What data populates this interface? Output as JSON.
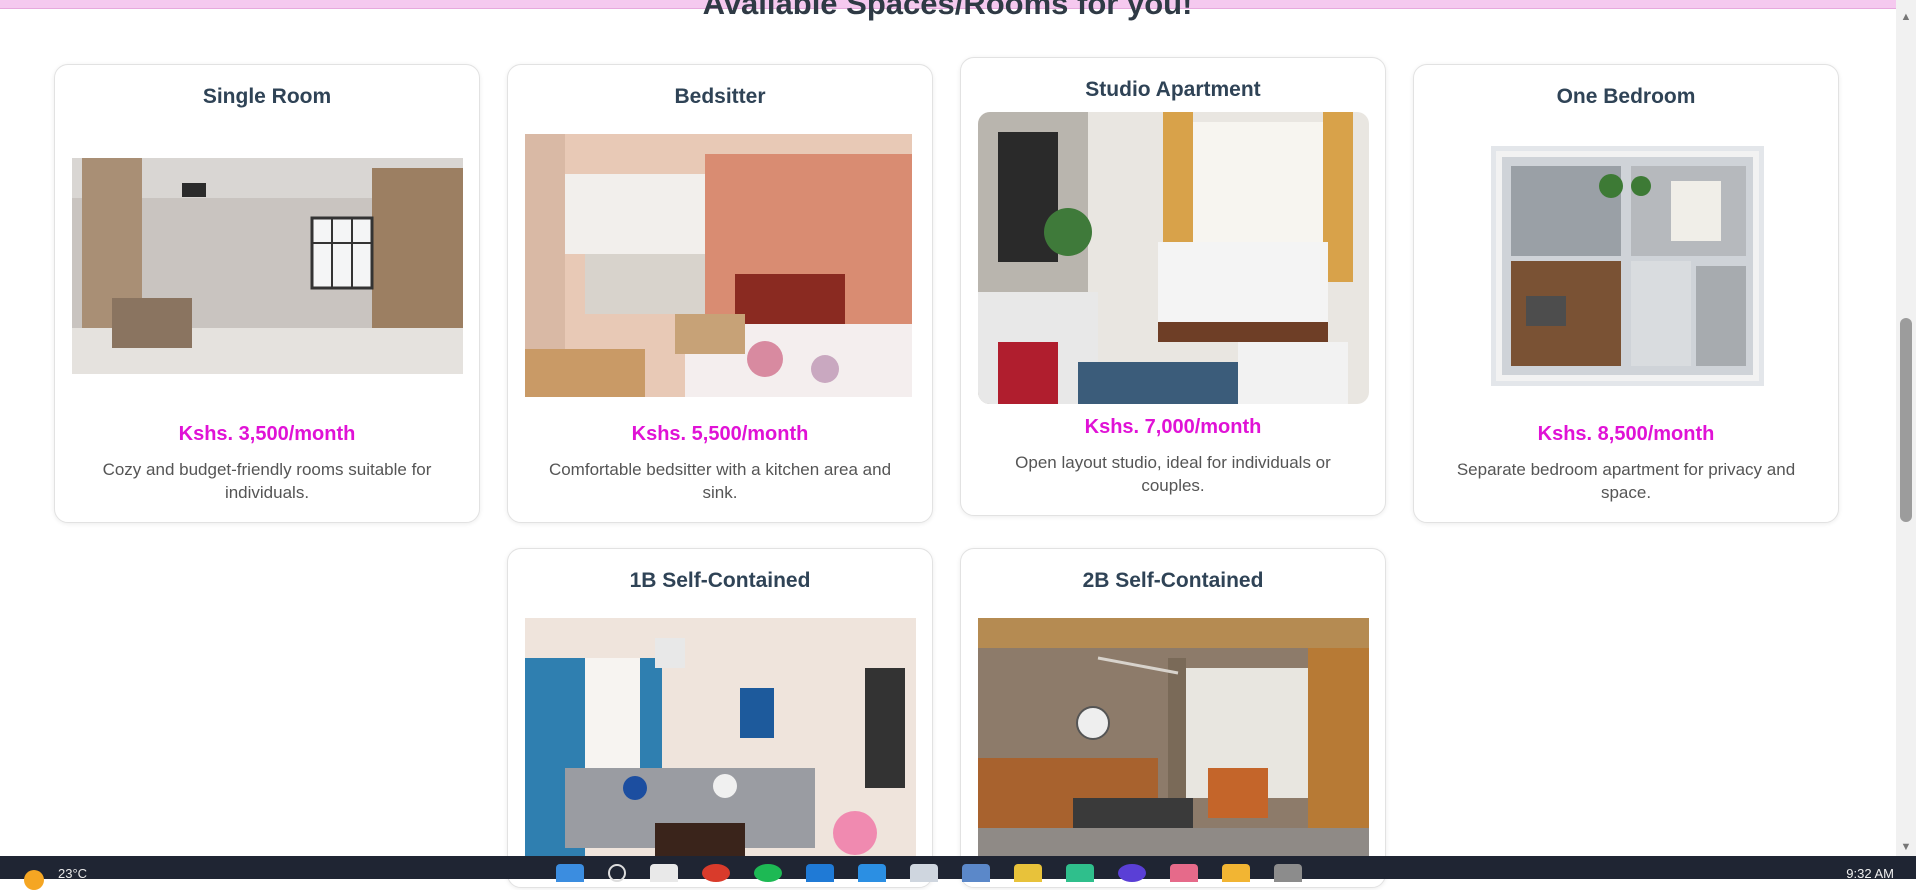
{
  "section": {
    "title": "Available Spaces/Rooms for you!"
  },
  "rooms": [
    {
      "name": "Single Room",
      "price": "Kshs. 3,500/month",
      "description": "Cozy and budget-friendly rooms suitable for individuals."
    },
    {
      "name": "Bedsitter",
      "price": "Kshs. 5,500/month",
      "description": "Comfortable bedsitter with a kitchen area and sink."
    },
    {
      "name": "Studio Apartment",
      "price": "Kshs. 7,000/month",
      "description": "Open layout studio, ideal for individuals or couples."
    },
    {
      "name": "One Bedroom",
      "price": "Kshs. 8,500/month",
      "description": "Separate bedroom apartment for privacy and space."
    },
    {
      "name": "1B Self-Contained"
    },
    {
      "name": "2B Self-Contained"
    }
  ],
  "colors": {
    "price": "#e012d6",
    "title": "#2f4356",
    "topbar": "#f5c9ef"
  },
  "taskbar": {
    "temperature": "23°C",
    "time": "9:32 AM",
    "icons": [
      "start-icon",
      "search-icon",
      "file-icon",
      "chrome-icon",
      "spotify-icon",
      "edge-icon",
      "vscode-icon",
      "notepad-icon",
      "monitor-icon",
      "python-icon",
      "pycharm-icon",
      "browser-icon",
      "paint-icon",
      "folder-icon",
      "settings-icon"
    ]
  }
}
